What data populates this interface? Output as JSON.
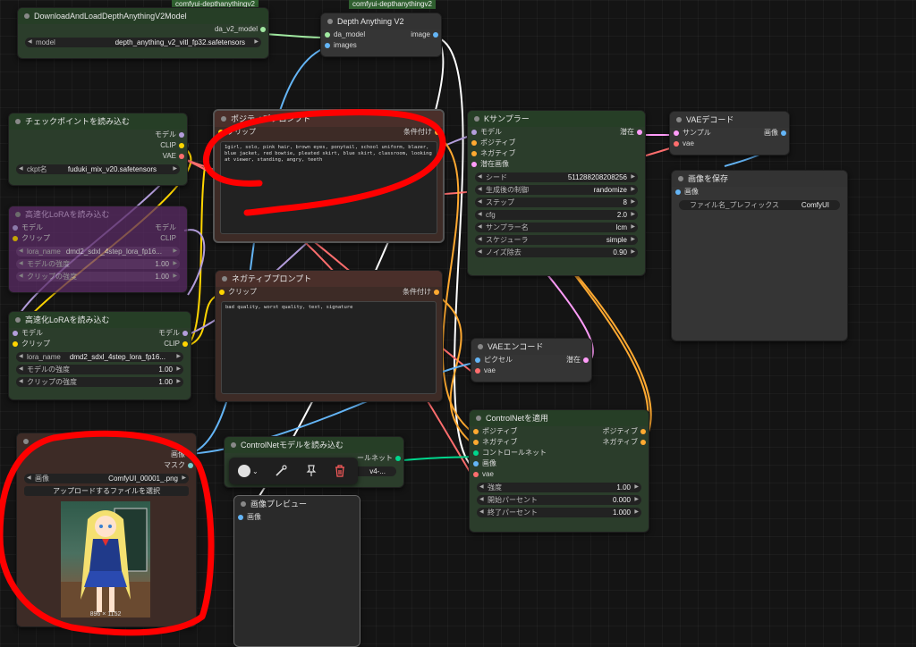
{
  "groups": [
    "comfyui-depthanythingv2",
    "comfyui-depthanythingv2"
  ],
  "nodes": {
    "dl": {
      "title": "DownloadAndLoadDepthAnythingV2Model",
      "out": "da_v2_model",
      "model_label": "model",
      "model_value": "depth_anything_v2_vitl_fp32.safetensors"
    },
    "depth": {
      "title": "Depth Anything V2",
      "in1": "da_model",
      "in2": "images",
      "out": "image"
    },
    "ckpt": {
      "title": "チェックポイントを読み込む",
      "out1": "モデル",
      "out2": "CLIP",
      "out3": "VAE",
      "label": "ckpt名",
      "value": "fuduki_mix_v20.safetensors"
    },
    "lora_bypassed": {
      "title": "高速化LoRAを読み込む",
      "in1": "モデル",
      "in2": "クリップ",
      "out1": "モデル",
      "out2": "CLIP",
      "w1_label": "lora_name",
      "w1_value": "dmd2_sdxl_4step_lora_fp16...",
      "w2_label": "モデルの強度",
      "w2_value": "1.00",
      "w3_label": "クリップの強度",
      "w3_value": "1.00"
    },
    "lora": {
      "title": "高速化LoRAを読み込む",
      "in1": "モデル",
      "in2": "クリップ",
      "out1": "モデル",
      "out2": "CLIP",
      "w1_label": "lora_name",
      "w1_value": "dmd2_sdxl_4step_lora_fp16...",
      "w2_label": "モデルの強度",
      "w2_value": "1.00",
      "w3_label": "クリップの強度",
      "w3_value": "1.00"
    },
    "pos": {
      "title": "ポジティブプロンプト",
      "in": "クリップ",
      "out": "条件付け",
      "text": "1girl, solo, pink hair, brown eyes, ponytail, school uniform, blazer, blue jacket, red bowtie, pleated skirt, blue skirt, classroom, looking at viewer, standing, angry, teeth"
    },
    "neg": {
      "title": "ネガティブプロンプト",
      "in": "クリップ",
      "out": "条件付け",
      "text": "bad quality, worst quality, text, signature"
    },
    "ks": {
      "title": "Kサンプラー",
      "in1": "モデル",
      "in2": "ポジティブ",
      "in3": "ネガティブ",
      "in4": "潜在画像",
      "out": "潜在",
      "widgets": [
        {
          "label": "シード",
          "value": "511288208208256"
        },
        {
          "label": "生成後の制御",
          "value": "randomize"
        },
        {
          "label": "ステップ",
          "value": "8"
        },
        {
          "label": "cfg",
          "value": "2.0"
        },
        {
          "label": "サンプラー名",
          "value": "lcm"
        },
        {
          "label": "スケジューラ",
          "value": "simple"
        },
        {
          "label": "ノイズ除去",
          "value": "0.90"
        }
      ]
    },
    "vaedec": {
      "title": "VAEデコード",
      "in1": "サンプル",
      "in2": "vae",
      "out": "画像"
    },
    "save": {
      "title": "画像を保存",
      "in": "画像",
      "label": "ファイル名_プレフィックス",
      "value": "ComfyUI"
    },
    "vaeenc": {
      "title": "VAEエンコード",
      "in1": "ピクセル",
      "in2": "vae",
      "out": "潜在"
    },
    "cn": {
      "title": "ControlNetを適用",
      "in1": "ポジティブ",
      "in2": "ネガティブ",
      "in3": "コントロールネット",
      "in4": "画像",
      "in5": "vae",
      "out1": "ポジティブ",
      "out2": "ネガティブ",
      "widgets": [
        {
          "label": "強度",
          "value": "1.00"
        },
        {
          "label": "開始パーセント",
          "value": "0.000"
        },
        {
          "label": "終了パーセント",
          "value": "1.000"
        }
      ]
    },
    "cnload": {
      "title": "ControlNetモデルを読み込む",
      "out": "ールネット",
      "value": "v4-..."
    },
    "loadimg": {
      "out1": "画像",
      "out2": "マスク",
      "label": "画像",
      "value": "ComfyUI_00001_.png",
      "upload": "アップロードするファイルを選択",
      "size": "896 × 1152"
    },
    "preview": {
      "title": "画像プレビュー",
      "in": "画像"
    }
  },
  "colors": {
    "model": "#b39ddb",
    "clip": "#ffd500",
    "vae": "#ff6e6e",
    "conditioning": "#ffa931",
    "latent": "#ff9cf9",
    "image": "#64b5f6",
    "cn": "#00d78d",
    "da": "#a1e9a1",
    "annotation": "#ff0000"
  }
}
